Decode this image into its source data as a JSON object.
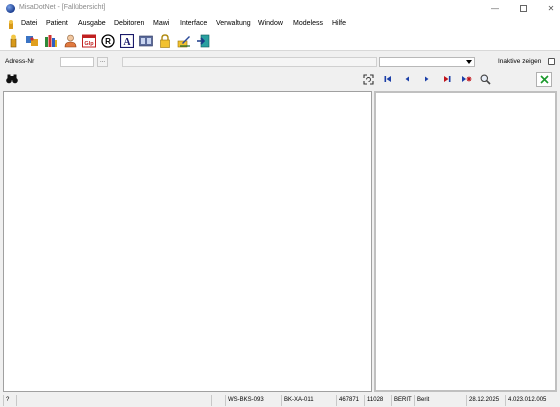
{
  "window": {
    "title": "MisaDotNet - [Fallübersicht]"
  },
  "menu": {
    "items": [
      "Datei",
      "Patient",
      "Ausgabe",
      "Debitoren",
      "Mawi",
      "Interface",
      "Verwaltung",
      "Window",
      "Modeless",
      "Hilfe"
    ]
  },
  "toolbar": {
    "icons": [
      "wand-icon",
      "puzzle-icon",
      "books-icon",
      "person-icon",
      "calendar-icon",
      "registered-icon",
      "letter-a-icon",
      "film-icon",
      "lock-icon",
      "pen-lock-icon",
      "export-icon"
    ],
    "calendar_text": "Glp",
    "registered_text": "R",
    "letter_text": "A"
  },
  "address": {
    "label": "Adress-Nr",
    "value": "",
    "browse_label": "...",
    "inactive_label": "Inaktive zeigen",
    "inactive_checked": false
  },
  "colors": {
    "nav_accent": "#1c3fa8",
    "nav_red": "#c0141b",
    "close_green": "#1b9a2c"
  },
  "statusbar": {
    "cells": [
      "?",
      "",
      "",
      "WS-BKS-093",
      "BK-XA-011",
      "467871",
      "11028",
      "BERIT",
      "Berit",
      "28.12.2025",
      "4.023.012.005"
    ]
  }
}
